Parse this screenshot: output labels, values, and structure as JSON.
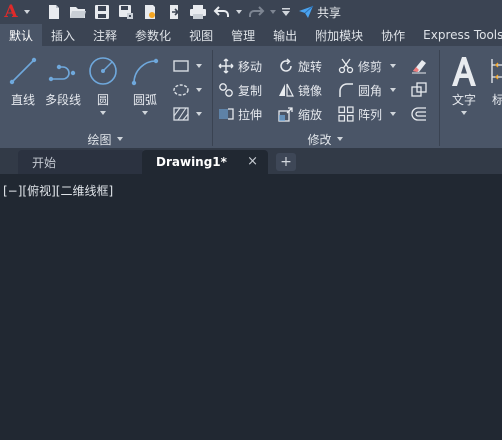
{
  "quick_access": {
    "app_logo": "A",
    "share_label": "共享",
    "icons": [
      "new-icon",
      "open-icon",
      "save-icon",
      "save-as-icon",
      "publish-icon",
      "export-icon",
      "plot-icon",
      "undo-icon",
      "redo-icon",
      "customize-icon"
    ]
  },
  "ribbon_tabs": [
    {
      "label": "默认",
      "active": true
    },
    {
      "label": "插入"
    },
    {
      "label": "注释"
    },
    {
      "label": "参数化"
    },
    {
      "label": "视图"
    },
    {
      "label": "管理"
    },
    {
      "label": "输出"
    },
    {
      "label": "附加模块"
    },
    {
      "label": "协作"
    },
    {
      "label": "Express Tools"
    }
  ],
  "draw_panel": {
    "title": "绘图",
    "line": "直线",
    "polyline": "多段线",
    "circle": "圆",
    "arc": "圆弧"
  },
  "modify_panel": {
    "title": "修改",
    "move": "移动",
    "rotate": "旋转",
    "trim": "修剪",
    "copy": "复制",
    "mirror": "镜像",
    "fillet": "圆角",
    "stretch": "拉伸",
    "scale": "缩放",
    "array": "阵列"
  },
  "annotation_panel": {
    "text": "文字",
    "dimension": "标"
  },
  "doc_tabs": {
    "home": "开始",
    "drawing": "Drawing1*",
    "close_glyph": "×",
    "add_glyph": "+"
  },
  "viewport": {
    "controls": "[−][俯视][二维线框]"
  },
  "colors": {
    "background": "#212832",
    "ribbon": "#4a5567",
    "toolbar": "#3b4453",
    "accent_icon": "#6fa8dc",
    "logo_red": "#e02a2a"
  }
}
